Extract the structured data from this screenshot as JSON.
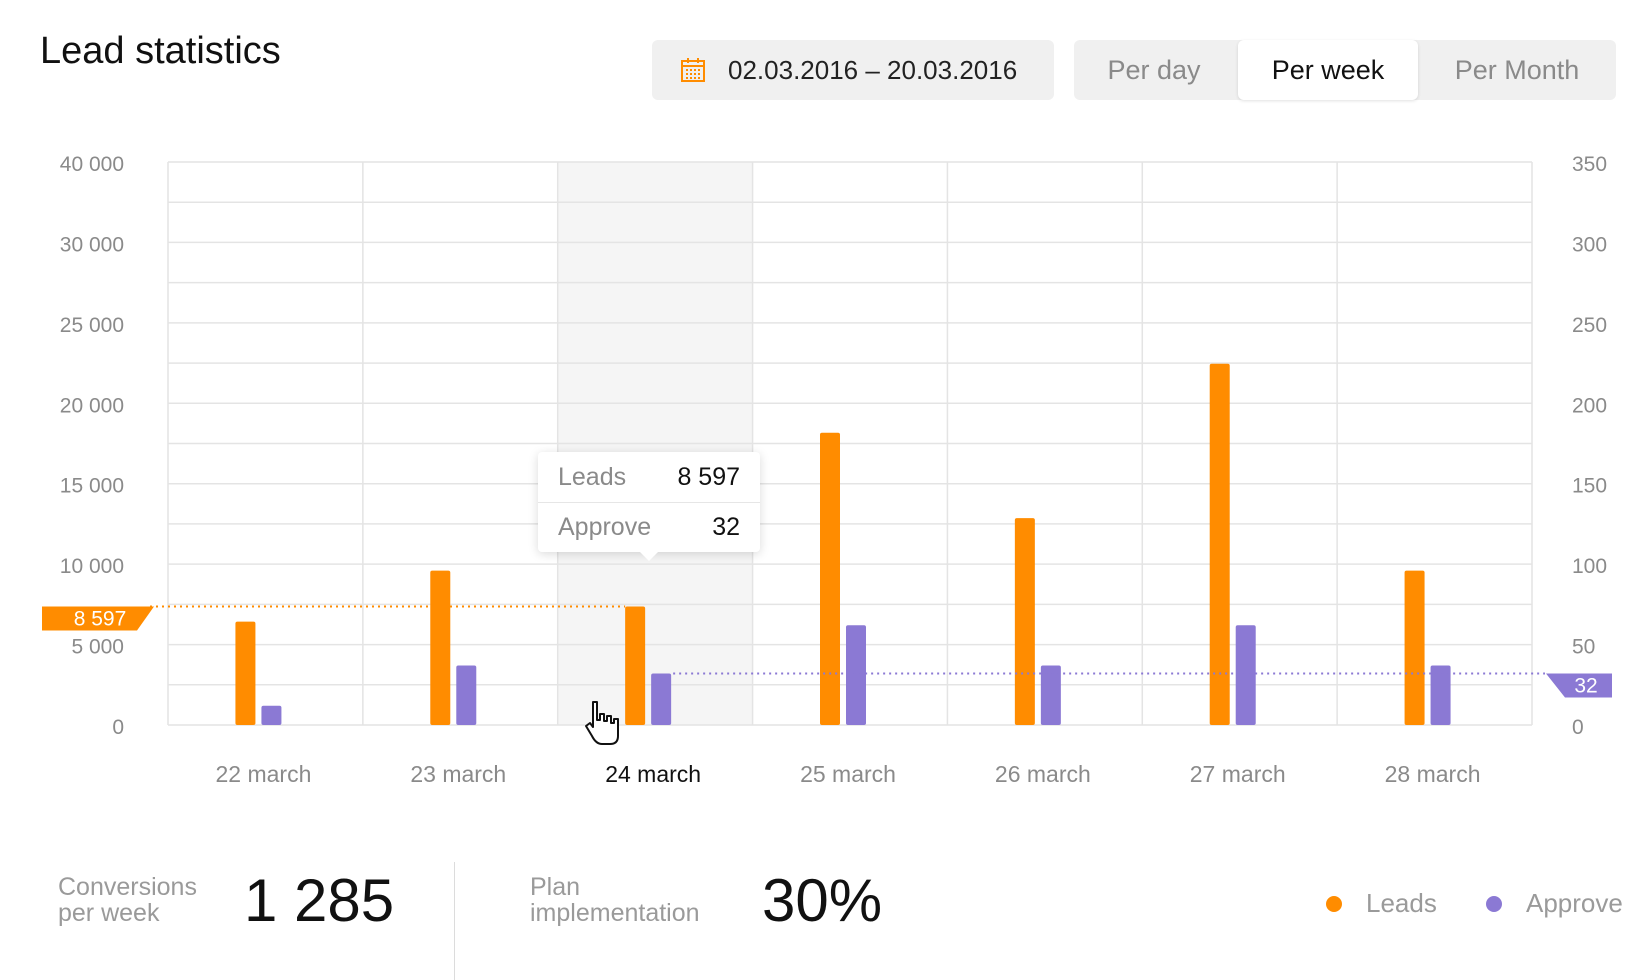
{
  "header": {
    "title": "Lead statistics",
    "date_range": "02.03.2016 – 20.03.2016",
    "periods": [
      {
        "label": "Per day",
        "active": false
      },
      {
        "label": "Per week",
        "active": true
      },
      {
        "label": "Per Month",
        "active": false
      }
    ]
  },
  "colors": {
    "leads": "#ff8c00",
    "approve": "#8b79d4",
    "grid": "#e4e4e4",
    "highlight": "#f5f5f5"
  },
  "chart_data": {
    "type": "bar",
    "categories": [
      "22 march",
      "23 march",
      "24 march",
      "25 march",
      "26 march",
      "27 march",
      "28 march"
    ],
    "series": [
      {
        "name": "Leads",
        "axis": "left",
        "values": [
          7500,
          11200,
          8597,
          21200,
          15000,
          26200,
          11200
        ]
      },
      {
        "name": "Approve",
        "axis": "right",
        "values": [
          12,
          37,
          32,
          62,
          37,
          62,
          37
        ]
      }
    ],
    "left_axis_ticks": [
      "40 000",
      "30 000",
      "25 000",
      "20 000",
      "15 000",
      "10 000",
      "5 000",
      "0"
    ],
    "right_axis_ticks": [
      "350",
      "300",
      "250",
      "200",
      "150",
      "100",
      "50",
      "0"
    ],
    "left_ylim": [
      0,
      35000
    ],
    "right_ylim": [
      0,
      350
    ],
    "grid": true,
    "highlighted_category": "24 march",
    "marker_leads_label": "8 597",
    "marker_approve_label": "32"
  },
  "tooltip": {
    "leads_label": "Leads",
    "leads_value": "8 597",
    "approve_label": "Approve",
    "approve_value": "32"
  },
  "stats": {
    "conversions_label_1": "Conversions",
    "conversions_label_2": "per week",
    "conversions_value": "1 285",
    "plan_label_1": "Plan",
    "plan_label_2": "implementation",
    "plan_value": "30%"
  },
  "legend": [
    {
      "label": "Leads"
    },
    {
      "label": "Approve"
    }
  ]
}
